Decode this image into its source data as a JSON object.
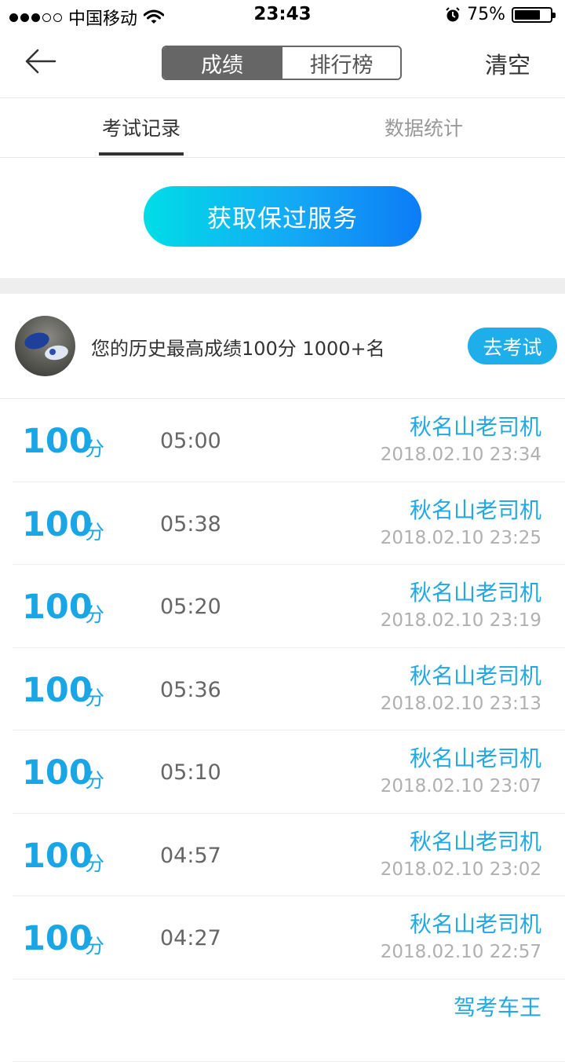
{
  "status_bar": {
    "carrier": "中国移动",
    "time": "23:43",
    "battery": "75%",
    "battery_level": 0.75
  },
  "nav": {
    "segments": [
      "成绩",
      "排行榜"
    ],
    "active_segment": 0,
    "clear_label": "清空"
  },
  "tabs": [
    {
      "label": "考试记录"
    },
    {
      "label": "数据统计"
    }
  ],
  "promo_button": "获取保过服务",
  "best": {
    "text": "您的历史最高成绩100分 1000+名",
    "button": "去考试"
  },
  "score_unit": "分",
  "records": [
    {
      "score": "100",
      "duration": "05:00",
      "name": "秋名山老司机",
      "date": "2018.02.10 23:34"
    },
    {
      "score": "100",
      "duration": "05:38",
      "name": "秋名山老司机",
      "date": "2018.02.10 23:25"
    },
    {
      "score": "100",
      "duration": "05:20",
      "name": "秋名山老司机",
      "date": "2018.02.10 23:19"
    },
    {
      "score": "100",
      "duration": "05:36",
      "name": "秋名山老司机",
      "date": "2018.02.10 23:13"
    },
    {
      "score": "100",
      "duration": "05:10",
      "name": "秋名山老司机",
      "date": "2018.02.10 23:07"
    },
    {
      "score": "100",
      "duration": "04:57",
      "name": "秋名山老司机",
      "date": "2018.02.10 23:02"
    },
    {
      "score": "100",
      "duration": "04:27",
      "name": "秋名山老司机",
      "date": "2018.02.10 22:57"
    },
    {
      "score": "",
      "duration": "",
      "name": "驾考车王",
      "date": ""
    }
  ],
  "colors": {
    "accent": "#1aa6e5",
    "segment_active": "#666666",
    "promo_start": "#00dde6",
    "promo_end": "#0c7cf6"
  }
}
